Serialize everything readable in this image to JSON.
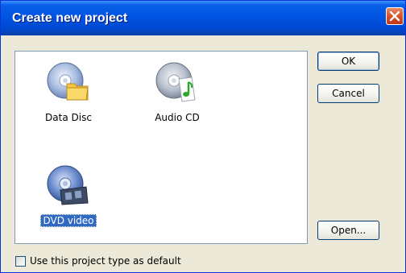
{
  "window": {
    "title": "Create new project"
  },
  "projects": [
    {
      "label": "Data Disc",
      "icon": "data-disc-icon",
      "selected": false
    },
    {
      "label": "Audio CD",
      "icon": "audio-cd-icon",
      "selected": false
    },
    {
      "label": "DVD video",
      "icon": "dvd-video-icon",
      "selected": true
    }
  ],
  "buttons": {
    "ok": "OK",
    "cancel": "Cancel",
    "open": "Open..."
  },
  "default_checkbox": {
    "label": "Use this project type as default",
    "checked": false
  },
  "colors": {
    "titlebar": "#0054e3",
    "dialog_bg": "#ece9d8",
    "selection": "#316ac5",
    "close_button": "#d8522b"
  }
}
